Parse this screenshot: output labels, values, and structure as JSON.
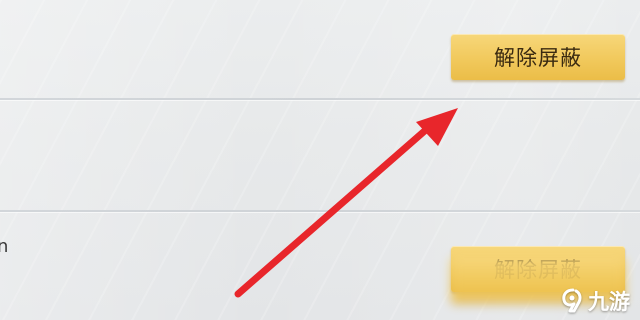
{
  "list": {
    "rows": [
      {
        "button_label": "解除屏蔽"
      },
      {
        "button_label": "解除屏蔽"
      },
      {
        "button_label": "",
        "stub_text": "n"
      }
    ]
  },
  "watermark": {
    "icon": "jiuyou-logo-icon",
    "text": "九游"
  },
  "colors": {
    "button_top": "#f7d77a",
    "button_bottom": "#ebbd48",
    "arrow": "#e8262b",
    "background": "#e8eaeb"
  }
}
